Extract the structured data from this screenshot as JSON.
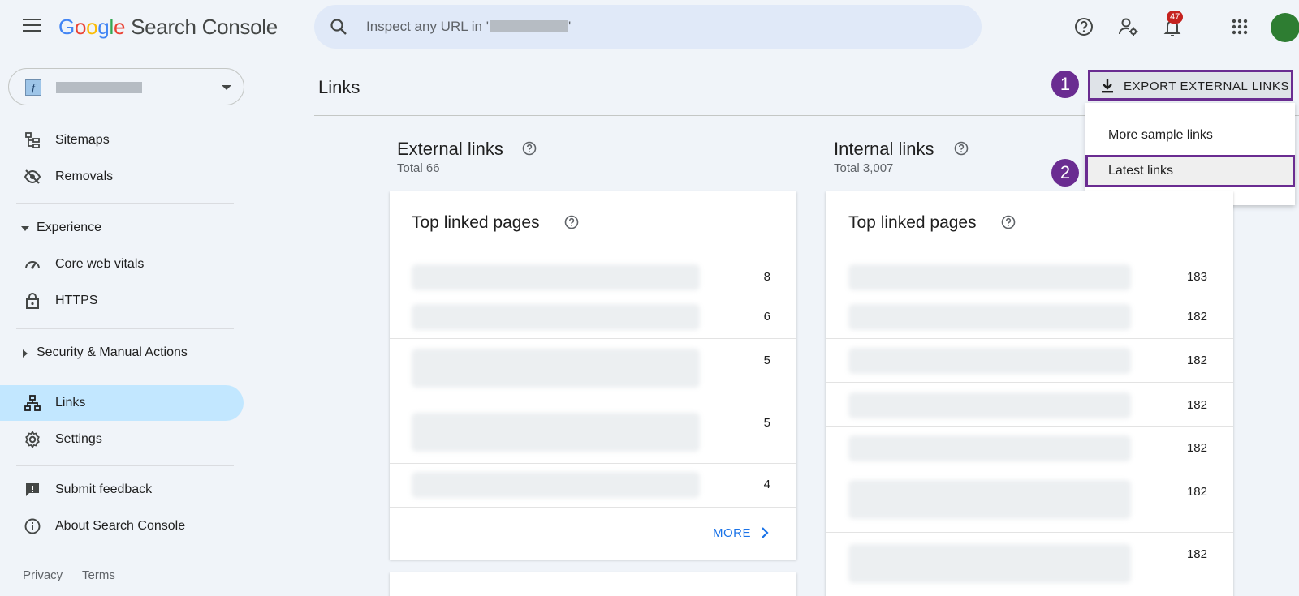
{
  "header": {
    "logo_google": [
      "G",
      "o",
      "o",
      "g",
      "l",
      "e"
    ],
    "logo_product": "Search Console",
    "search_prefix": "Inspect any URL in '",
    "search_suffix": "'",
    "notification_count": "47"
  },
  "sidebar": {
    "items": [
      {
        "label": "Sitemaps",
        "icon": "sitemap-icon"
      },
      {
        "label": "Removals",
        "icon": "eye-off-icon"
      },
      {
        "label": "Core web vitals",
        "icon": "speed-icon"
      },
      {
        "label": "HTTPS",
        "icon": "lock-icon"
      },
      {
        "label": "Links",
        "icon": "links-icon",
        "active": true
      },
      {
        "label": "Settings",
        "icon": "gear-icon"
      },
      {
        "label": "Submit feedback",
        "icon": "feedback-icon"
      },
      {
        "label": "About Search Console",
        "icon": "info-icon"
      }
    ],
    "sections": {
      "experience": "Experience",
      "security": "Security & Manual Actions"
    },
    "footer": {
      "privacy": "Privacy",
      "terms": "Terms"
    }
  },
  "main": {
    "title": "Links",
    "export_label": "EXPORT EXTERNAL LINKS",
    "steps": [
      "1",
      "2"
    ],
    "dropdown": [
      "More sample links",
      "Latest links"
    ],
    "external": {
      "title": "External links",
      "total": "Total 66",
      "card_title": "Top linked pages",
      "counts": [
        "8",
        "6",
        "5",
        "5",
        "4"
      ],
      "more": "MORE"
    },
    "internal": {
      "title": "Internal links",
      "total": "Total 3,007",
      "card_title": "Top linked pages",
      "counts": [
        "183",
        "182",
        "182",
        "182",
        "182",
        "182",
        "182"
      ]
    }
  },
  "colors": {
    "accent": "#6a2c91",
    "active_nav": "#c2e7ff",
    "link": "#1a73e8",
    "badge": "#c5221f"
  }
}
